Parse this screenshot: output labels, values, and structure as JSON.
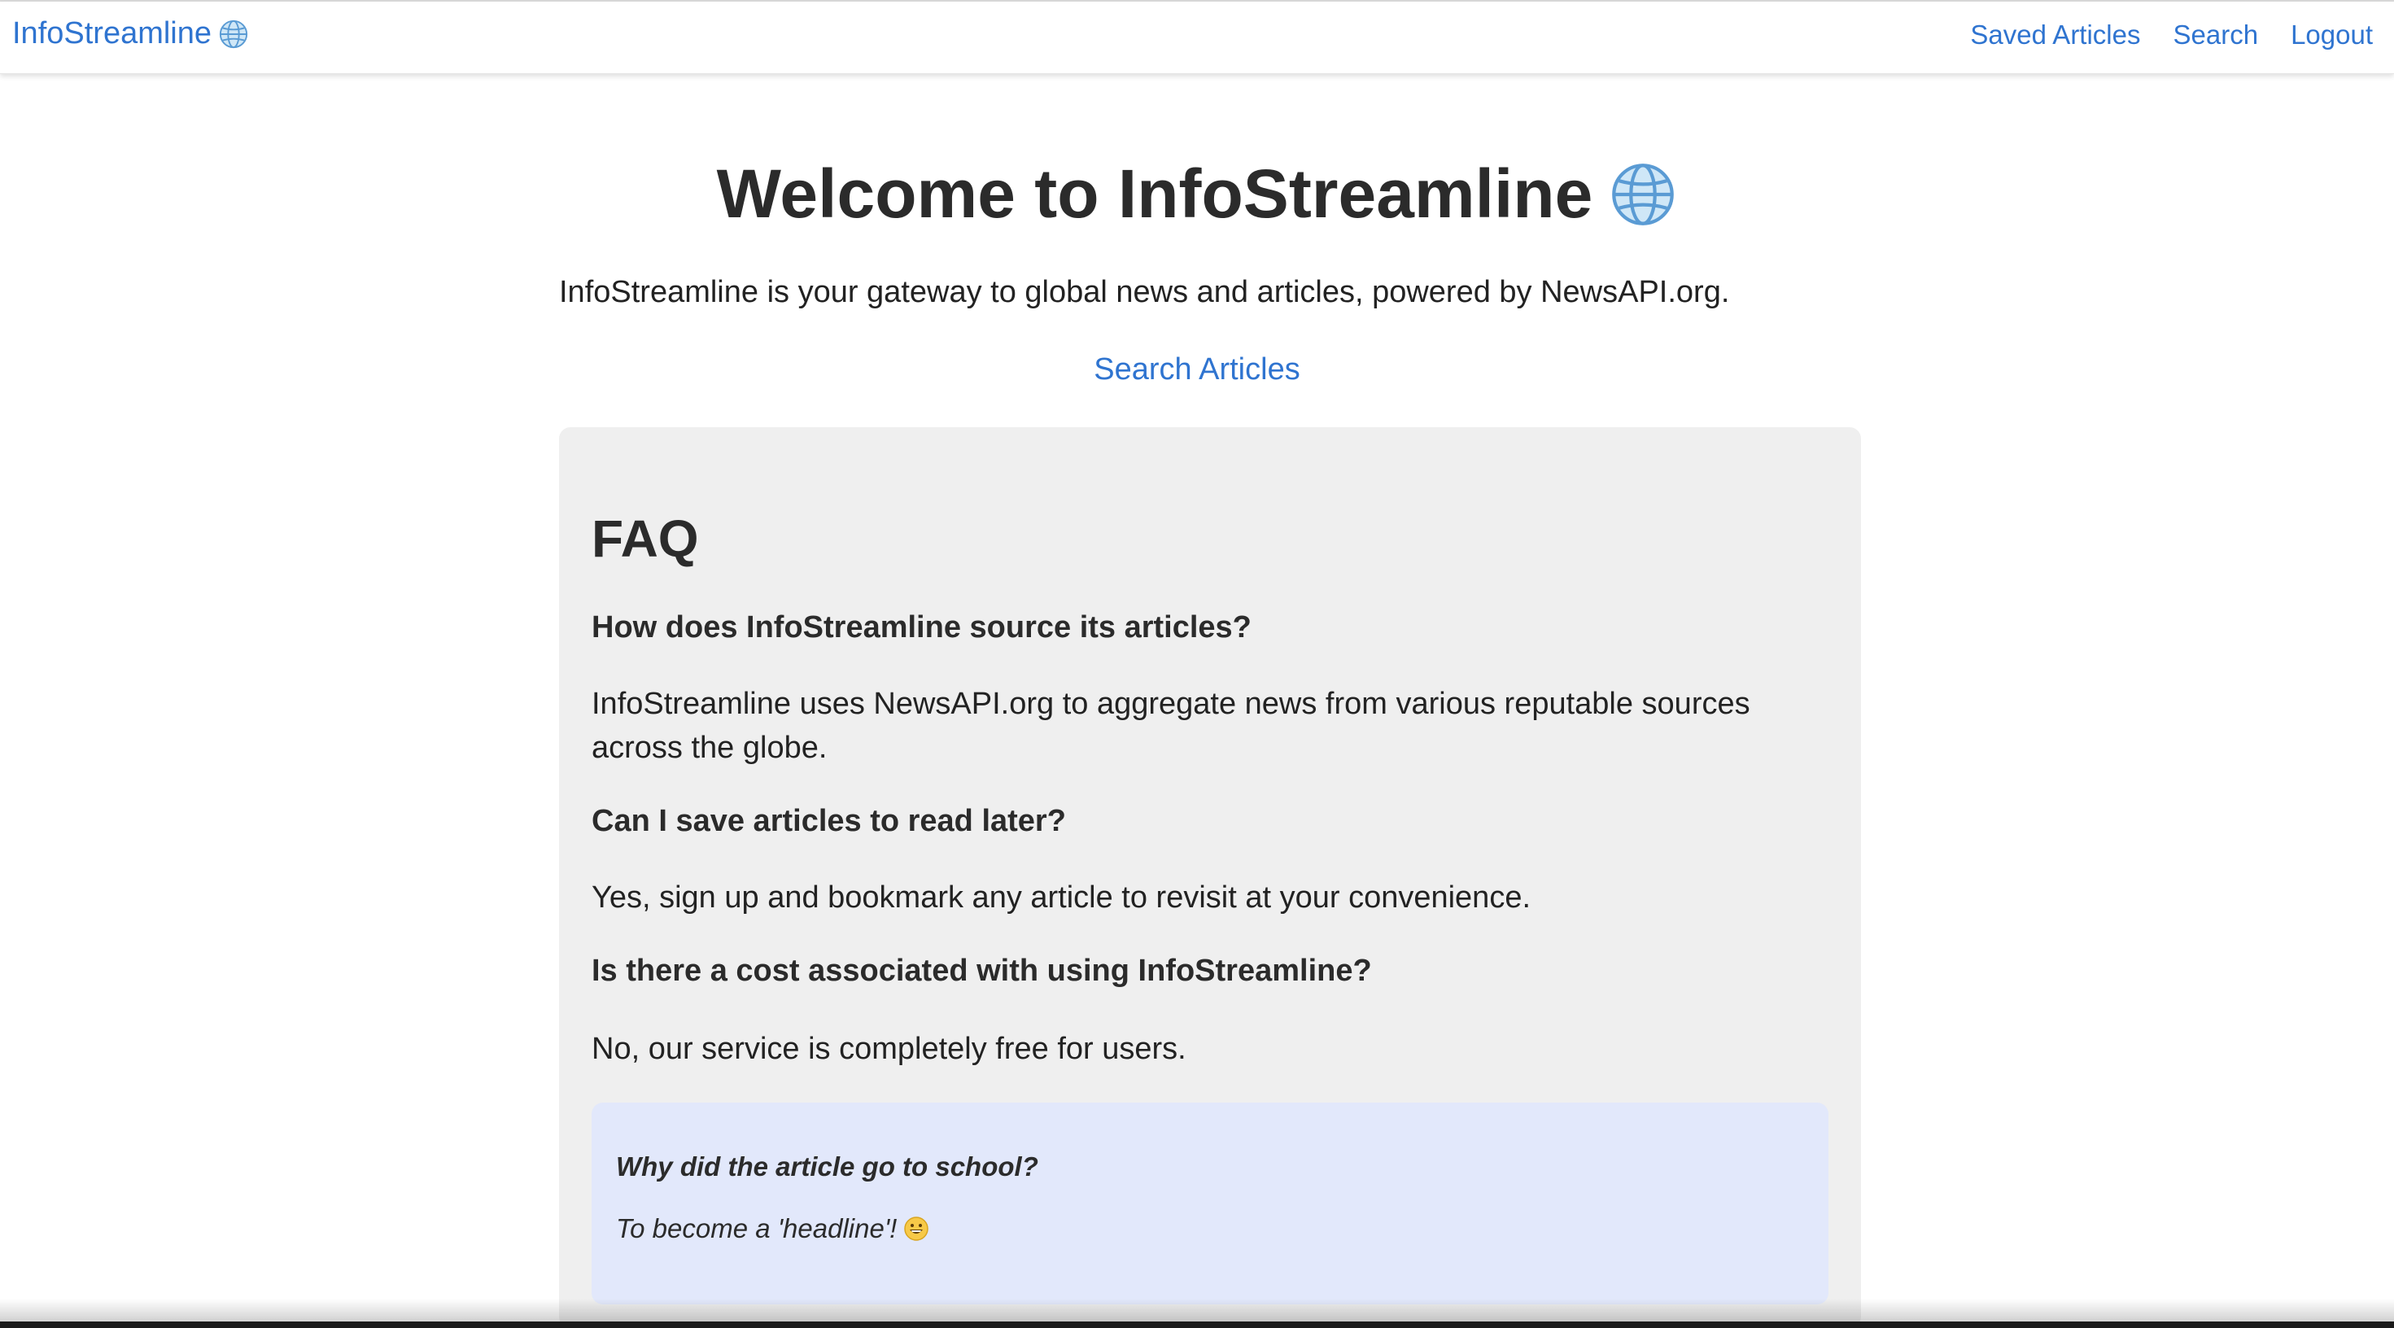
{
  "navbar": {
    "brand": "InfoStreamline",
    "links": [
      "Saved Articles",
      "Search",
      "Logout"
    ]
  },
  "hero": {
    "title": "Welcome to InfoStreamline",
    "intro": "InfoStreamline is your gateway to global news and articles, powered by NewsAPI.org.",
    "search_link": "Search Articles"
  },
  "faq": {
    "title": "FAQ",
    "items": [
      {
        "question": "How does InfoStreamline source its articles?",
        "answer": "InfoStreamline uses NewsAPI.org to aggregate news from various reputable sources across the globe."
      },
      {
        "question": "Can I save articles to read later?",
        "answer": "Yes, sign up and bookmark any article to revisit at your convenience."
      },
      {
        "question": "Is there a cost associated with using InfoStreamline?",
        "answer": "No, our service is completely free for users."
      }
    ],
    "joke": {
      "question": "Why did the article go to school?",
      "answer": "To become a 'headline'!"
    }
  },
  "icons": {
    "globe": "globe-icon",
    "emoji": "grinning-face-icon"
  },
  "colors": {
    "link": "#2f74d0",
    "card_bg": "#efefef",
    "joke_bg": "#e2e8fb"
  }
}
